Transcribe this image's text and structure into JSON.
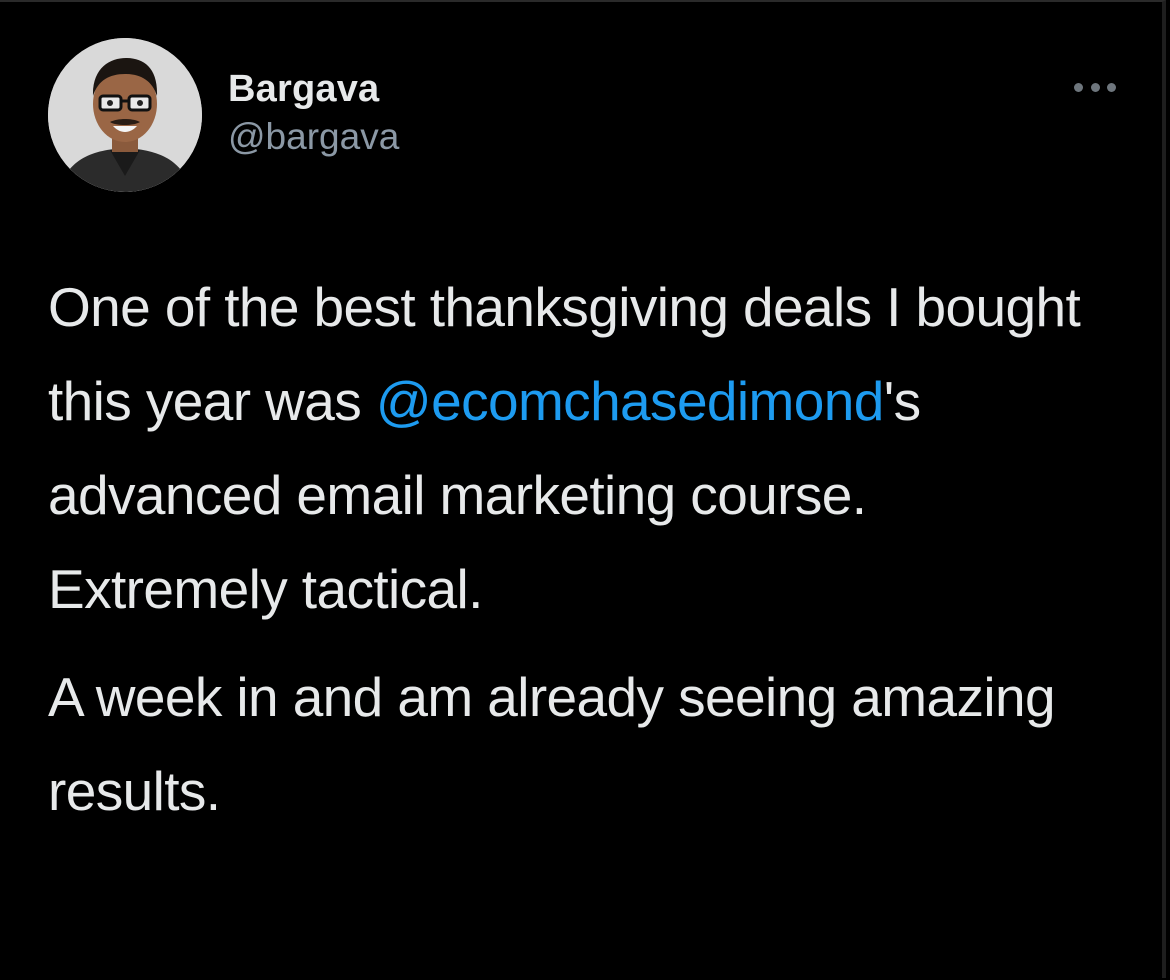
{
  "author": {
    "display_name": "Bargava",
    "handle": "@bargava",
    "avatar_icon": "profile-photo"
  },
  "menu": {
    "icon": "more-options-icon"
  },
  "tweet": {
    "paragraph1": {
      "before_mention": "One of the best thanksgiving deals I bought this year was ",
      "mention": "@ecomchasedimond",
      "after_mention": "'s advanced email marketing course. Extremely tactical."
    },
    "paragraph2": "A week in and am already seeing amazing results."
  },
  "colors": {
    "background": "#000000",
    "text": "#e7e9ea",
    "secondary_text": "#8b98a5",
    "link": "#1d9bf0"
  }
}
